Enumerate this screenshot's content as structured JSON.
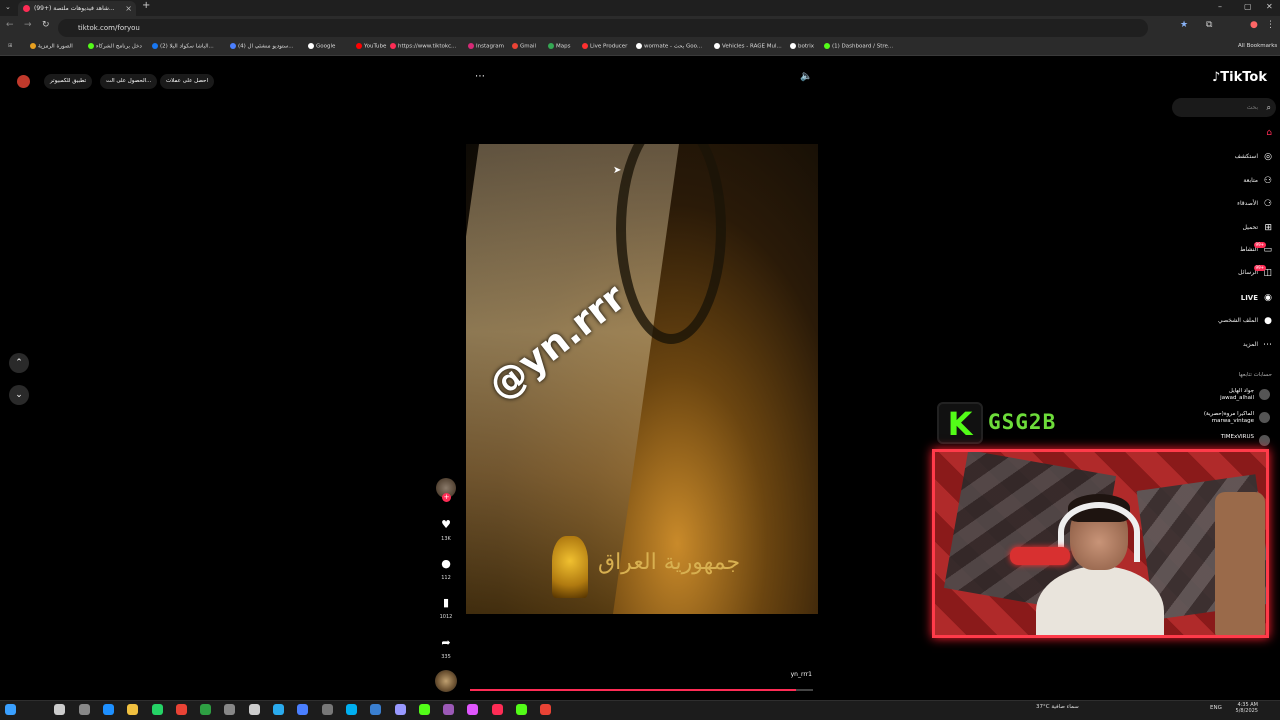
{
  "browser": {
    "tab_title": "(99+) شاهد فيديوهات ملتصة...",
    "url": "tiktok.com/foryou",
    "bookmarks": [
      {
        "label": "الصورة الرمزية",
        "color": "#e8a020"
      },
      {
        "label": "دخل برنامج الشركاء",
        "color": "#53fc18"
      },
      {
        "label": "(2) الباشا سكواد البلا...",
        "color": "#1877f2"
      },
      {
        "label": "(4) ستوديو منشئي ال...",
        "color": "#4a7fff"
      },
      {
        "label": "Google",
        "color": "#ffffff"
      },
      {
        "label": "YouTube",
        "color": "#ff0000"
      },
      {
        "label": "https://www.tiktokc...",
        "color": "#fe2c55"
      },
      {
        "label": "Instagram",
        "color": "#d62976"
      },
      {
        "label": "Gmail",
        "color": "#ea4335"
      },
      {
        "label": "Maps",
        "color": "#34a853"
      },
      {
        "label": "Live Producer",
        "color": "#ff3030"
      },
      {
        "label": "wormate - بحث Goo...",
        "color": "#ffffff"
      },
      {
        "label": "Vehicles - RAGE Mul...",
        "color": "#ffffff"
      },
      {
        "label": "botrix",
        "color": "#ffffff"
      },
      {
        "label": "(1) Dashboard / Stre...",
        "color": "#53fc18"
      }
    ],
    "all_bookmarks": "All Bookmarks"
  },
  "top_pills": {
    "get_coins": "احصل على عملات",
    "get_app": "الحصول على الت...",
    "pc_app": "تطبيق للكمبيوتر"
  },
  "video": {
    "watermark": "@yn.rrr",
    "emblem_text": "جمهورية العراق",
    "author_username": "yn_rrr1",
    "progress_fraction": 0.95
  },
  "actions": {
    "likes": "13K",
    "comments": "112",
    "saves": "1012",
    "shares": "335"
  },
  "sidebar": {
    "logo": "TikTok",
    "search_placeholder": "بحث",
    "nav": [
      {
        "label": "",
        "icon": "home-icon"
      },
      {
        "label": "استكشف",
        "icon": "compass-icon"
      },
      {
        "label": "متابعة",
        "icon": "follow-icon"
      },
      {
        "label": "الأصدقاء",
        "icon": "friends-icon"
      },
      {
        "label": "تحميل",
        "icon": "upload-icon"
      },
      {
        "label": "النشاط",
        "icon": "inbox-icon",
        "badge": "99+"
      },
      {
        "label": "الرسائل",
        "icon": "message-icon",
        "badge": "99+"
      },
      {
        "label": "LIVE",
        "icon": "live-icon"
      },
      {
        "label": "الملف الشخصي",
        "icon": "profile-icon"
      },
      {
        "label": "المزيد",
        "icon": "more-icon"
      }
    ],
    "following_heading": "حسابات تتابعها",
    "following": [
      {
        "name": "جواد الهايل",
        "handle": "jawad_alhail"
      },
      {
        "name": "الماكيرا مروة(حصرية)",
        "handle": "marwa_vintage"
      },
      {
        "name": "TIMExVIRUS",
        "handle": ""
      }
    ]
  },
  "overlay": {
    "kick_letter": "K",
    "streamer_name": "GSG2B"
  },
  "taskbar": {
    "weather": "37°C سماء صافية",
    "lang": "ENG",
    "time": "4:35 AM",
    "date": "5/8/2025"
  }
}
